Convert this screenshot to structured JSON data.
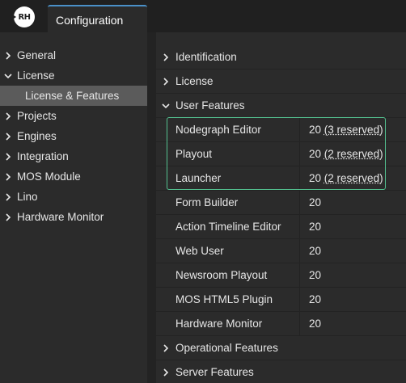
{
  "app": {
    "logo_text": "RH",
    "tab_label": "Configuration"
  },
  "sidebar": {
    "items": [
      {
        "label": "General",
        "expanded": false
      },
      {
        "label": "License",
        "expanded": true
      },
      {
        "label": "License & Features",
        "selected": true
      },
      {
        "label": "Projects",
        "expanded": false
      },
      {
        "label": "Engines",
        "expanded": false
      },
      {
        "label": "Integration",
        "expanded": false
      },
      {
        "label": "MOS Module",
        "expanded": false
      },
      {
        "label": "Lino",
        "expanded": false
      },
      {
        "label": "Hardware Monitor",
        "expanded": false
      }
    ]
  },
  "main": {
    "sections": {
      "identification": "Identification",
      "license": "License",
      "user_features": "User Features",
      "operational_features": "Operational Features",
      "server_features": "Server Features"
    },
    "user_features": [
      {
        "name": "Nodegraph Editor",
        "count": "20",
        "reserved": "(3 reserved)"
      },
      {
        "name": "Playout",
        "count": "20",
        "reserved": "(2 reserved)"
      },
      {
        "name": "Launcher",
        "count": "20",
        "reserved": "(2 reserved)"
      },
      {
        "name": "Form Builder",
        "count": "20"
      },
      {
        "name": "Action Timeline Editor",
        "count": "20"
      },
      {
        "name": "Web User",
        "count": "20"
      },
      {
        "name": "Newsroom Playout",
        "count": "20"
      },
      {
        "name": "MOS HTML5 Plugin",
        "count": "20"
      },
      {
        "name": "Hardware Monitor",
        "count": "20"
      }
    ]
  },
  "colors": {
    "highlight_border": "#53c08f",
    "tab_accent": "#4a90c8",
    "selected_bg": "#5b5b5b"
  }
}
